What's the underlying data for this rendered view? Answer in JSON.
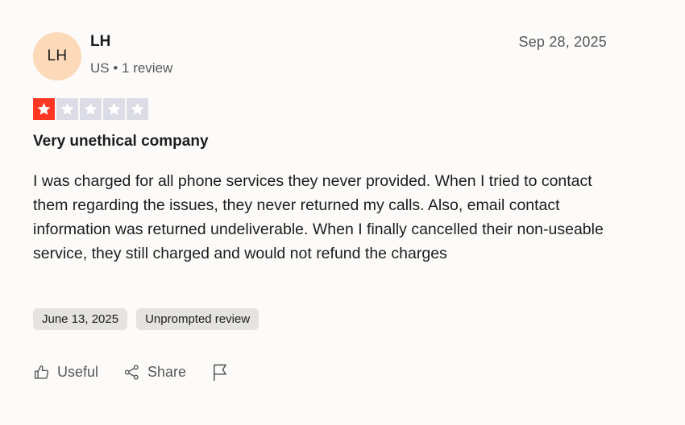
{
  "reviewer": {
    "initials": "LH",
    "name": "LH",
    "meta": "US • 1 review"
  },
  "review": {
    "date": "Sep 28, 2025",
    "rating": 1,
    "rating_max": 5,
    "title": "Very unethical company",
    "body": "I was charged for all phone services they never provided. When I tried to contact them regarding the issues, they never returned my calls. Also, email contact information was returned undeliverable. When I finally cancelled their non-useable service, they still charged and would not refund the charges",
    "tags": [
      "June 13, 2025",
      "Unprompted review"
    ]
  },
  "actions": {
    "useful_label": "Useful",
    "share_label": "Share"
  },
  "icons": {
    "useful": "thumbs-up-icon",
    "share": "share-icon",
    "report": "flag-icon",
    "star": "star-icon"
  },
  "colors": {
    "avatar_bg": "#fcd9b8",
    "star_filled": "#ff3722",
    "star_empty": "#dcdce6",
    "tag_bg": "#e5e3df",
    "page_bg": "#fcfbf9"
  }
}
